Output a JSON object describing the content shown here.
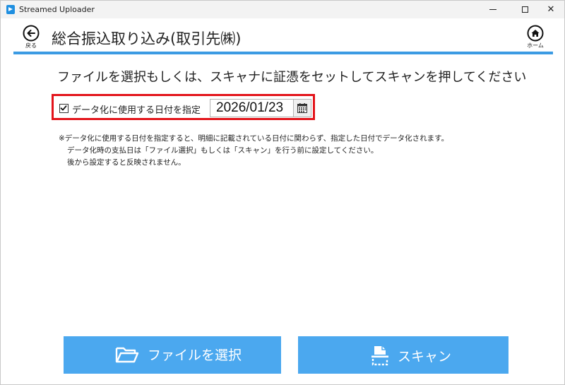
{
  "window": {
    "title": "Streamed Uploader",
    "controls": {
      "minimize": "—",
      "maximize": "☐",
      "close": "✕"
    }
  },
  "header": {
    "back_label": "戻る",
    "home_label": "ホーム",
    "title": "総合振込取り込み(取引先㈱)",
    "accent_color": "#3c9be3"
  },
  "main": {
    "instruction": "ファイルを選択もしくは、スキャナに証憑をセットしてスキャンを押してください",
    "date_option": {
      "checked": true,
      "label": "データ化に使用する日付を指定",
      "date_value": "2026/01/23",
      "highlight_color": "#e3131a"
    },
    "notes": [
      "※データ化に使用する日付を指定すると、明細に記載されている日付に関わらず、指定した日付でデータ化されます。",
      "データ化時の支払日は「ファイル選択」もしくは「スキャン」を行う前に設定してください。",
      "後から設定すると反映されません。"
    ]
  },
  "actions": {
    "select_file_label": "ファイルを選択",
    "scan_label": "スキャン",
    "button_color": "#4ba8ef"
  },
  "icons": {
    "app": "app-icon",
    "back": "back-arrow-icon",
    "home": "home-icon",
    "calendar": "calendar-icon",
    "folder": "folder-icon",
    "scanner": "scanner-icon"
  }
}
